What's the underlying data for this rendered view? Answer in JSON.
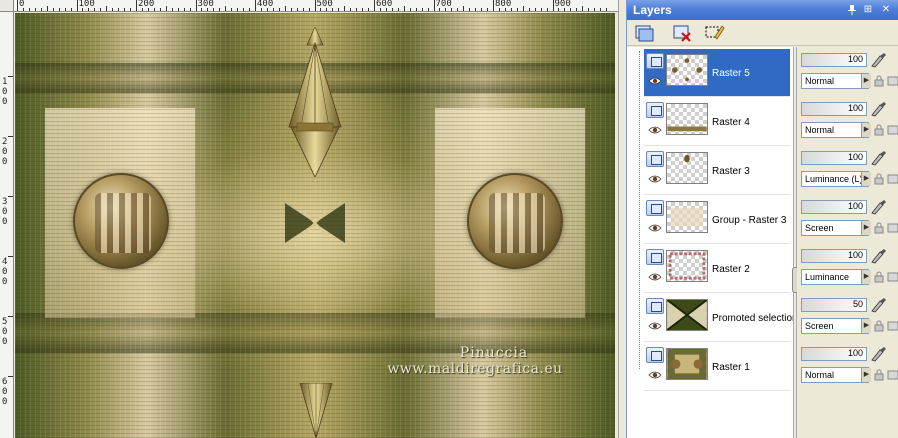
{
  "ruler": {
    "top_labels": [
      "0",
      "100",
      "200",
      "300",
      "400",
      "500",
      "600",
      "700",
      "800",
      "900"
    ],
    "left_labels": [
      [
        "1",
        "0",
        "0"
      ],
      [
        "2",
        "0",
        "0"
      ],
      [
        "3",
        "0",
        "0"
      ],
      [
        "4",
        "0",
        "0"
      ],
      [
        "5",
        "0",
        "0"
      ],
      [
        "6",
        "0",
        "0"
      ]
    ]
  },
  "canvas": {
    "watermark_line1": "Pinuccia",
    "watermark_line2": "www.maldiregrafica.eu"
  },
  "palette": {
    "title": "Layers",
    "title_buttons": [
      "⊞",
      "■",
      "✕"
    ],
    "accent_color": "#3a6ccf",
    "selected_color": "#316ac5"
  },
  "layers": [
    {
      "name": "Raster 5",
      "opacity": "100",
      "blend": "Normal",
      "selected": true,
      "thumb": "dots"
    },
    {
      "name": "Raster 4",
      "opacity": "100",
      "blend": "Normal",
      "selected": false,
      "thumb": "line"
    },
    {
      "name": "Raster 3",
      "opacity": "100",
      "blend": "Luminance (L)",
      "selected": false,
      "thumb": "dot"
    },
    {
      "name": "Group - Raster 3",
      "opacity": "100",
      "blend": "Screen",
      "selected": false,
      "thumb": "faint"
    },
    {
      "name": "Raster 2",
      "opacity": "100",
      "blend": "Luminance",
      "selected": false,
      "thumb": "frame"
    },
    {
      "name": "Promoted selection",
      "opacity": "50",
      "blend": "Screen",
      "selected": false,
      "thumb": "pattern"
    },
    {
      "name": "Raster 1",
      "opacity": "100",
      "blend": "Normal",
      "selected": false,
      "thumb": "image"
    }
  ]
}
